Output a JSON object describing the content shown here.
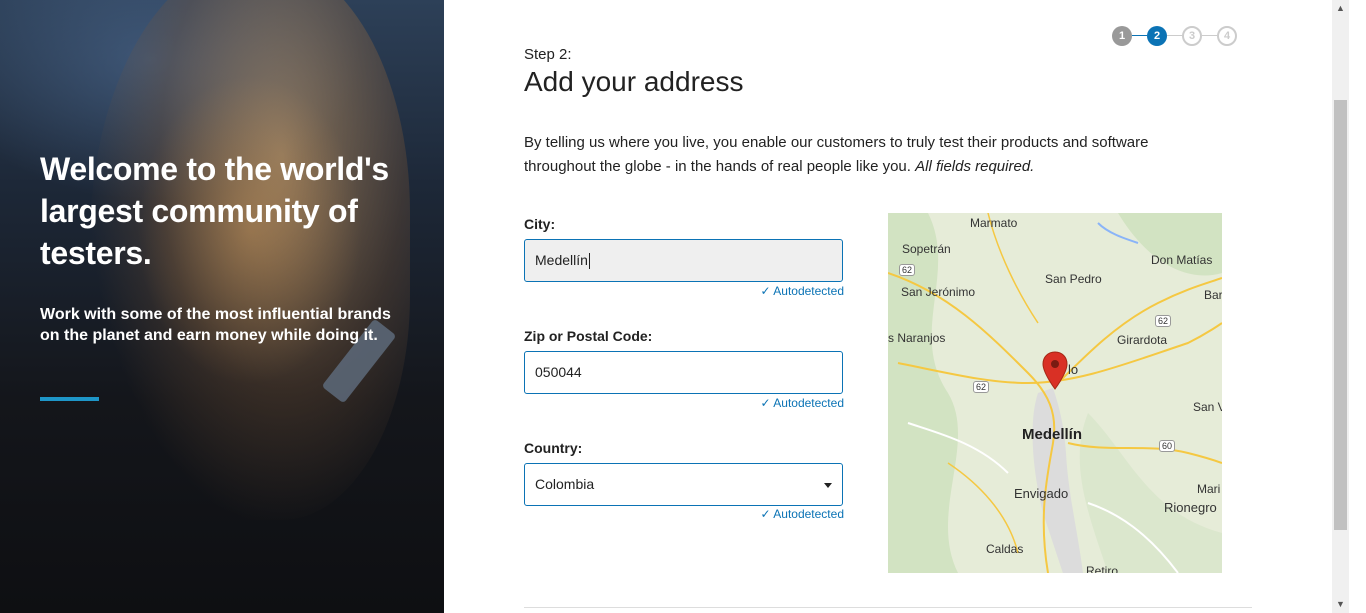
{
  "hero": {
    "title": "Welcome to the world's largest community of testers.",
    "subtitle": "Work with some of the most influential brands on the planet and earn money while doing it.",
    "accent_color": "#1e96c8"
  },
  "steps": [
    {
      "number": "1",
      "state": "done"
    },
    {
      "number": "2",
      "state": "active"
    },
    {
      "number": "3",
      "state": "todo"
    },
    {
      "number": "4",
      "state": "todo"
    }
  ],
  "header": {
    "step_label": "Step 2:",
    "title": "Add your address"
  },
  "intro": {
    "text": "By telling us where you live, you enable our customers to truly test their products and software throughout the globe - in the hands of real people like you. ",
    "required_note": "All fields required."
  },
  "form": {
    "city": {
      "label": "City:",
      "value": "Medellín",
      "status": "Autodetected"
    },
    "zip": {
      "label": "Zip or Postal Code:",
      "value": "050044",
      "status": "Autodetected"
    },
    "country": {
      "label": "Country:",
      "value": "Colombia",
      "status": "Autodetected"
    }
  },
  "map": {
    "labels": {
      "marmato": "Marmato",
      "sopetran": "Sopetrán",
      "don_matias": "Don Matías",
      "san_pedro": "San Pedro",
      "san_jeronimo": "San Jerónimo",
      "bar": "Bar",
      "naranjos": "s Naranjos",
      "girardota": "Girardota",
      "bello_partial": "lo",
      "san_v": "San V",
      "medellin": "Medellín",
      "envigado": "Envigado",
      "mari": "Mari",
      "rionegro": "Rionegro",
      "caldas": "Caldas",
      "retiro": "Retiro",
      "route_62a": "62",
      "route_62b": "62",
      "route_62c": "62",
      "route_60": "60"
    },
    "pin_color": "#d93025"
  },
  "colors": {
    "primary": "#0b73b5",
    "step_done": "#999999"
  }
}
